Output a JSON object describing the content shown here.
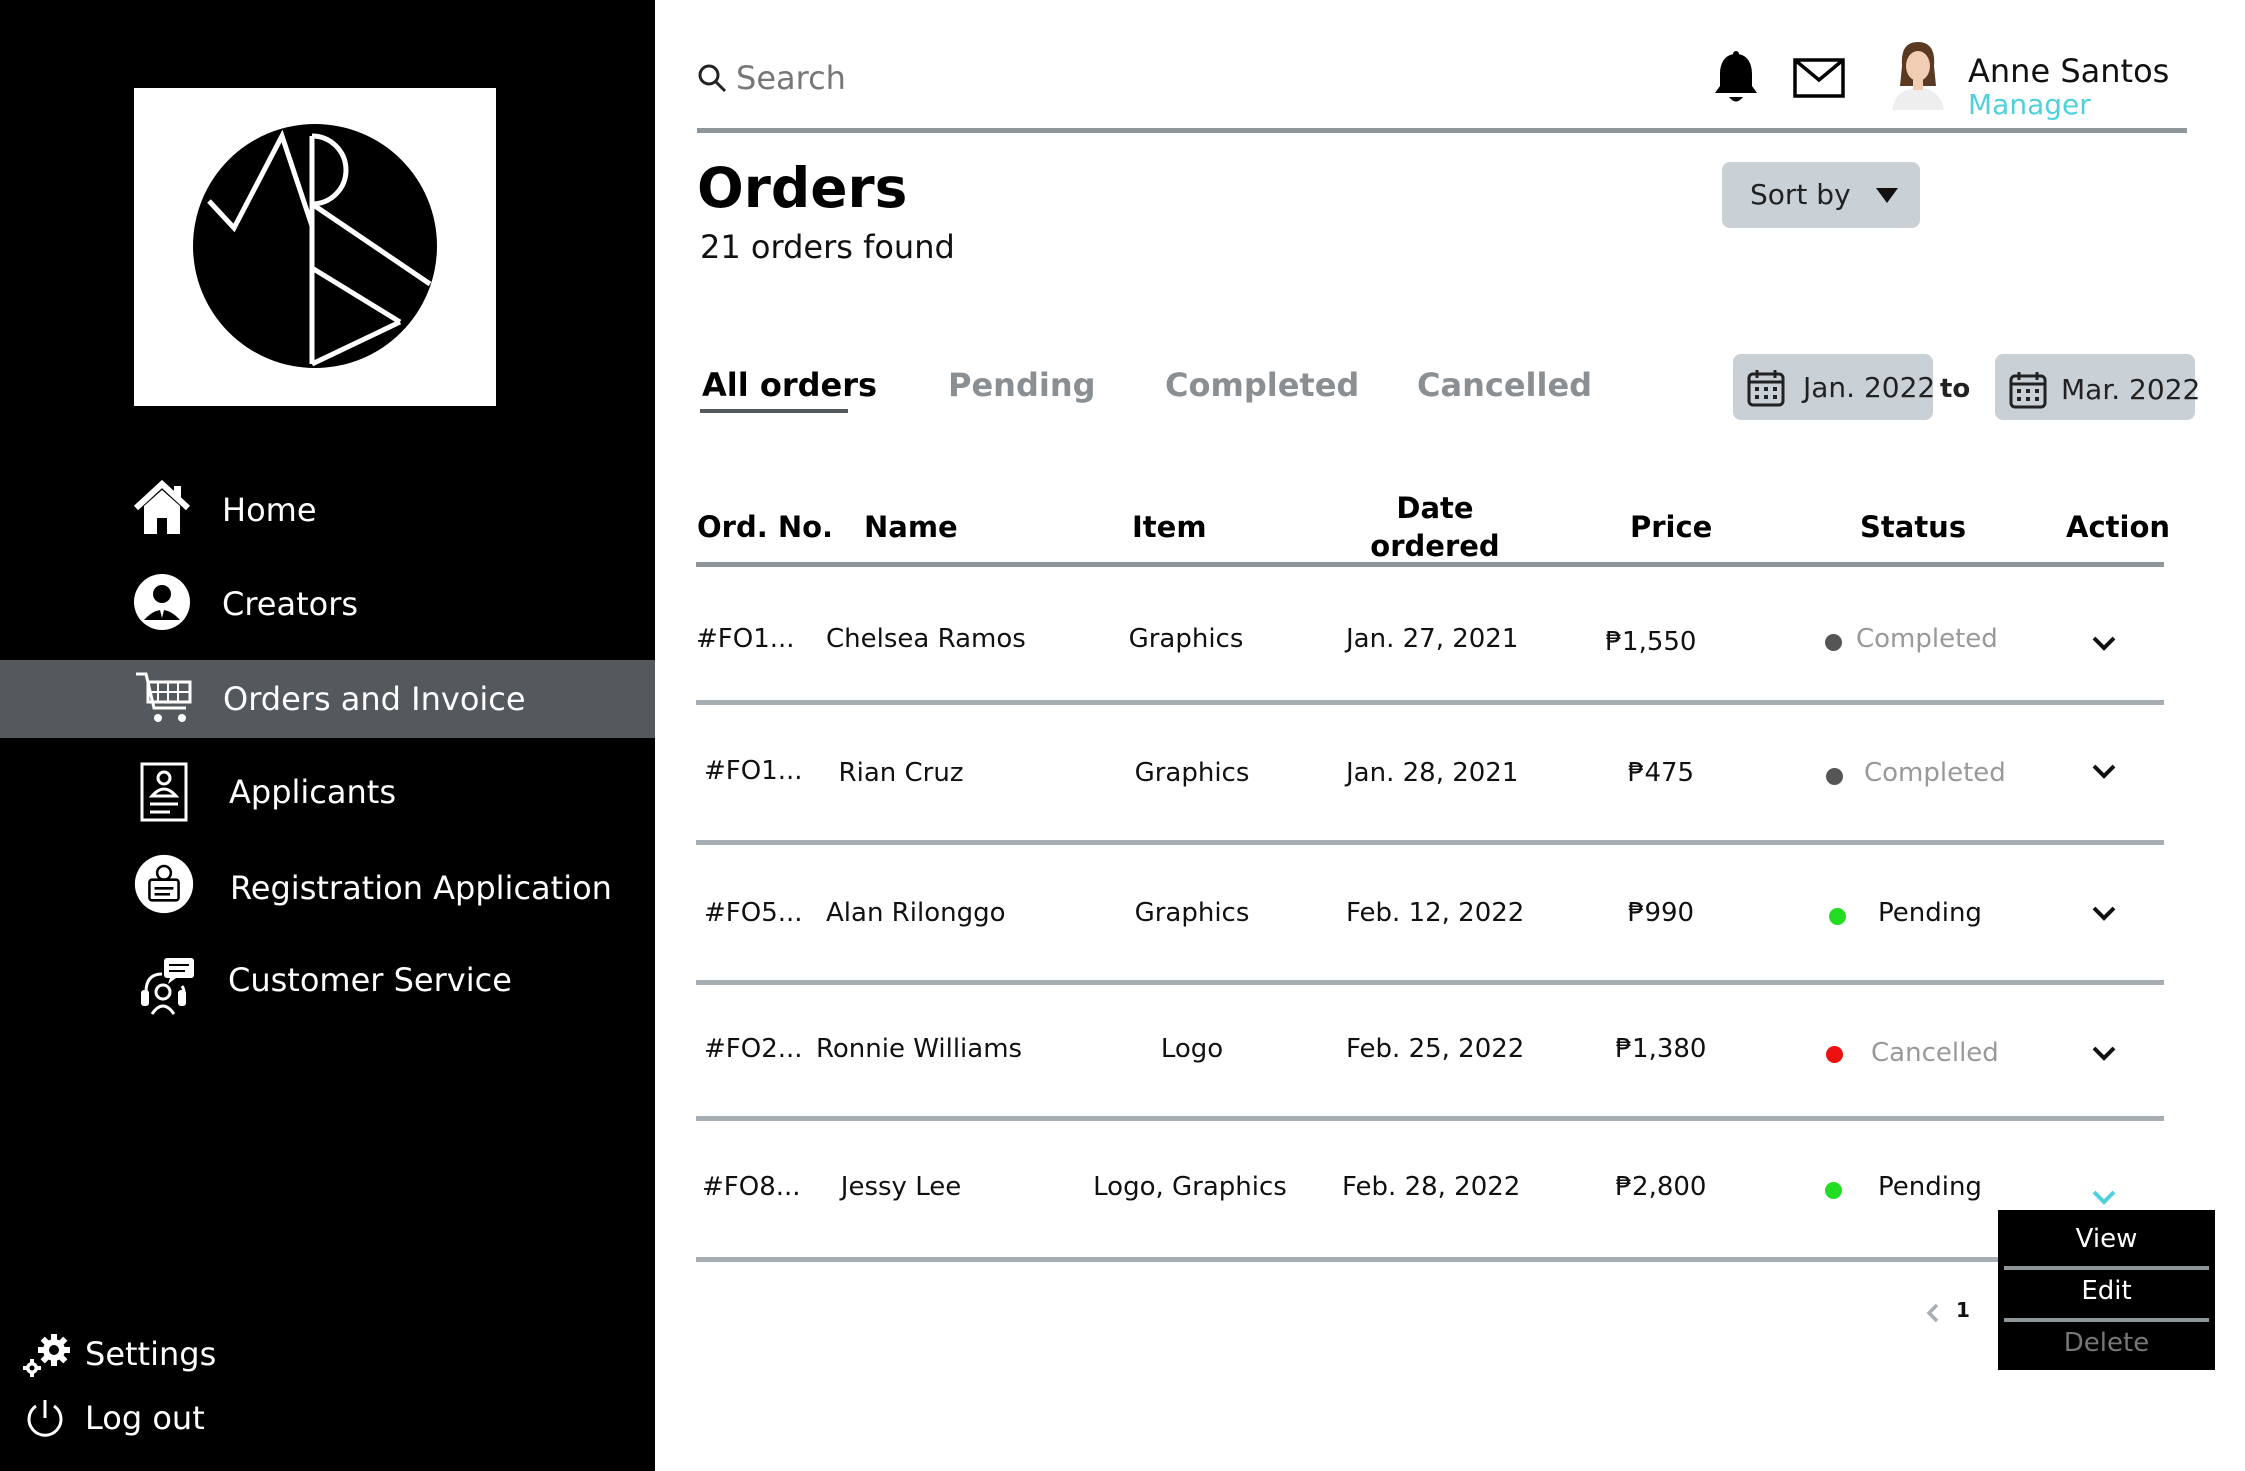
{
  "sidebar": {
    "nav": [
      {
        "label": "Home",
        "icon": "home-icon"
      },
      {
        "label": "Creators",
        "icon": "creators-icon"
      },
      {
        "label": "Orders and Invoice",
        "icon": "cart-icon",
        "active": true
      },
      {
        "label": "Applicants",
        "icon": "applicant-badge-icon"
      },
      {
        "label": "Registration Application",
        "icon": "registration-icon"
      },
      {
        "label": "Customer Service",
        "icon": "headset-icon"
      }
    ],
    "footer": {
      "settings_label": "Settings",
      "logout_label": "Log out"
    }
  },
  "header": {
    "search_placeholder": "Search",
    "user_name": "Anne Santos",
    "user_role": "Manager"
  },
  "page": {
    "title": "Orders",
    "count_text": "21 orders found",
    "sort_label": "Sort by"
  },
  "tabs": [
    "All orders",
    "Pending",
    "Completed",
    "Cancelled"
  ],
  "date_range": {
    "from": "Jan. 2022",
    "to_label": "to",
    "to": "Mar. 2022"
  },
  "table": {
    "headers": {
      "order_no": "Ord. No.",
      "name": "Name",
      "item": "Item",
      "date_line1": "Date",
      "date_line2": "ordered",
      "price": "Price",
      "status": "Status",
      "action": "Action"
    },
    "rows": [
      {
        "order_no": "#FO1...",
        "name": "Chelsea Ramos",
        "item": "Graphics",
        "date": "Jan. 27, 2021",
        "price": "₱1,550",
        "status": "Completed"
      },
      {
        "order_no": "#FO1...",
        "name": "Rian Cruz",
        "item": "Graphics",
        "date": "Jan. 28, 2021",
        "price": "₱475",
        "status": "Completed"
      },
      {
        "order_no": "#FO5...",
        "name": "Alan Rilonggo",
        "item": "Graphics",
        "date": "Feb. 12, 2022",
        "price": "₱990",
        "status": "Pending"
      },
      {
        "order_no": "#FO2...",
        "name": "Ronnie Williams",
        "item": "Logo",
        "date": "Feb. 25, 2022",
        "price": "₱1,380",
        "status": "Cancelled"
      },
      {
        "order_no": "#FO8...",
        "name": "Jessy Lee",
        "item": "Logo, Graphics",
        "date": "Feb. 28, 2022",
        "price": "₱2,800",
        "status": "Pending"
      }
    ]
  },
  "status_colors": {
    "Completed": "#555555",
    "Pending": "#22dd22",
    "Cancelled": "#ee1111"
  },
  "action_menu": {
    "items": [
      "View",
      "Edit",
      "Delete"
    ]
  },
  "pagination": {
    "current": "1"
  },
  "colors": {
    "sidebar_bg": "#000000",
    "active_nav_bg": "#54595d",
    "accent": "#4fd1d9"
  }
}
